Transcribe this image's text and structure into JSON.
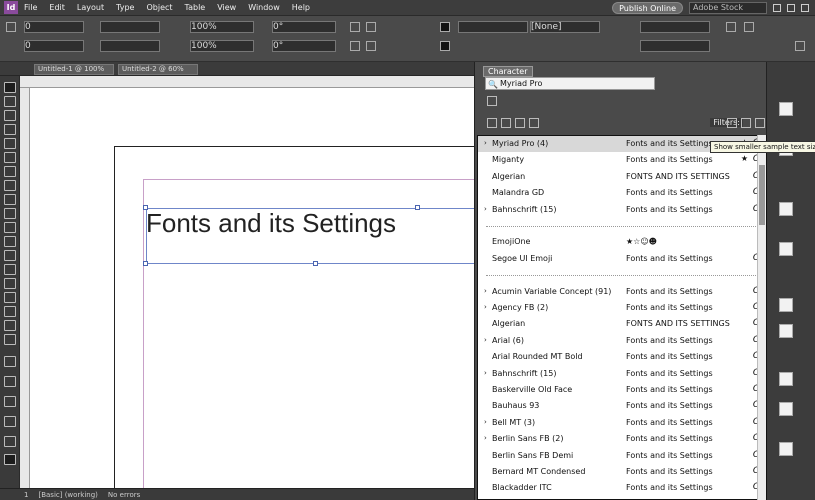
{
  "menubar": {
    "items": [
      "File",
      "Edit",
      "Layout",
      "Type",
      "Object",
      "Table",
      "View",
      "Window",
      "Help"
    ],
    "publish_label": "Publish Online",
    "search_placeholder": "Adobe Stock"
  },
  "controlbar": {
    "style_field": "[None]",
    "value_fields": [
      "0",
      "0",
      "100%",
      "100%",
      "0°",
      "0°"
    ]
  },
  "doc_tabs": [
    "Untitled-1 @ 100%",
    "Untitled-2 @ 60%"
  ],
  "canvas": {
    "headline": "Fonts and its Settings"
  },
  "statusbar": {
    "page": "1",
    "style": "[Basic] (working)",
    "errors": "No errors"
  },
  "panel": {
    "tab_label": "Character",
    "font_field_value": "Myriad Pro",
    "filter_label": "Filters:",
    "tooltip": "Show smaller sample text size"
  },
  "font_list": [
    {
      "name": "Myriad Pro (4)",
      "sample": "Fonts and its Settings",
      "expandable": true,
      "type": "O",
      "starred": true,
      "highlight": true
    },
    {
      "name": "Miganty",
      "sample": "Fonts and its Settings",
      "expandable": false,
      "type": "O",
      "starred": true
    },
    {
      "name": "Algerian",
      "sample": "FONTS AND ITS SETTINGS",
      "expandable": false,
      "type": "O"
    },
    {
      "name": "Malandra GD",
      "sample": "Fonts and its Settings",
      "expandable": false,
      "type": "O"
    },
    {
      "name": "Bahnschrift (15)",
      "sample": "Fonts and its Settings",
      "expandable": true,
      "type": "O"
    },
    {
      "separator": true
    },
    {
      "name": "EmojiOne",
      "sample": "★☆☺☻",
      "expandable": false,
      "type": ""
    },
    {
      "name": "Segoe UI Emoji",
      "sample": "Fonts and its Settings",
      "expandable": false,
      "type": "O"
    },
    {
      "separator": true
    },
    {
      "name": "Acumin Variable Concept (91)",
      "sample": "Fonts and its Settings",
      "expandable": true,
      "type": "O"
    },
    {
      "name": "Agency FB (2)",
      "sample": "Fonts and its Settings",
      "expandable": true,
      "type": "O"
    },
    {
      "name": "Algerian",
      "sample": "FONTS AND ITS SETTINGS",
      "expandable": false,
      "type": "O"
    },
    {
      "name": "Arial (6)",
      "sample": "Fonts and its Settings",
      "expandable": true,
      "type": "O"
    },
    {
      "name": "Arial Rounded MT Bold",
      "sample": "Fonts and its Settings",
      "expandable": false,
      "type": "O"
    },
    {
      "name": "Bahnschrift (15)",
      "sample": "Fonts and its Settings",
      "expandable": true,
      "type": "O"
    },
    {
      "name": "Baskerville Old Face",
      "sample": "Fonts and its Settings",
      "expandable": false,
      "type": "O"
    },
    {
      "name": "Bauhaus 93",
      "sample": "Fonts and its Settings",
      "expandable": false,
      "type": "O"
    },
    {
      "name": "Bell MT (3)",
      "sample": "Fonts and its Settings",
      "expandable": true,
      "type": "O"
    },
    {
      "name": "Berlin Sans FB (2)",
      "sample": "Fonts and its Settings",
      "expandable": true,
      "type": "O"
    },
    {
      "name": "Berlin Sans FB Demi",
      "sample": "Fonts and its Settings",
      "expandable": false,
      "type": "O"
    },
    {
      "name": "Bernard MT Condensed",
      "sample": "Fonts and its Settings",
      "expandable": false,
      "type": "O"
    },
    {
      "name": "Blackadder ITC",
      "sample": "Fonts and its Settings",
      "expandable": false,
      "type": "O"
    }
  ]
}
